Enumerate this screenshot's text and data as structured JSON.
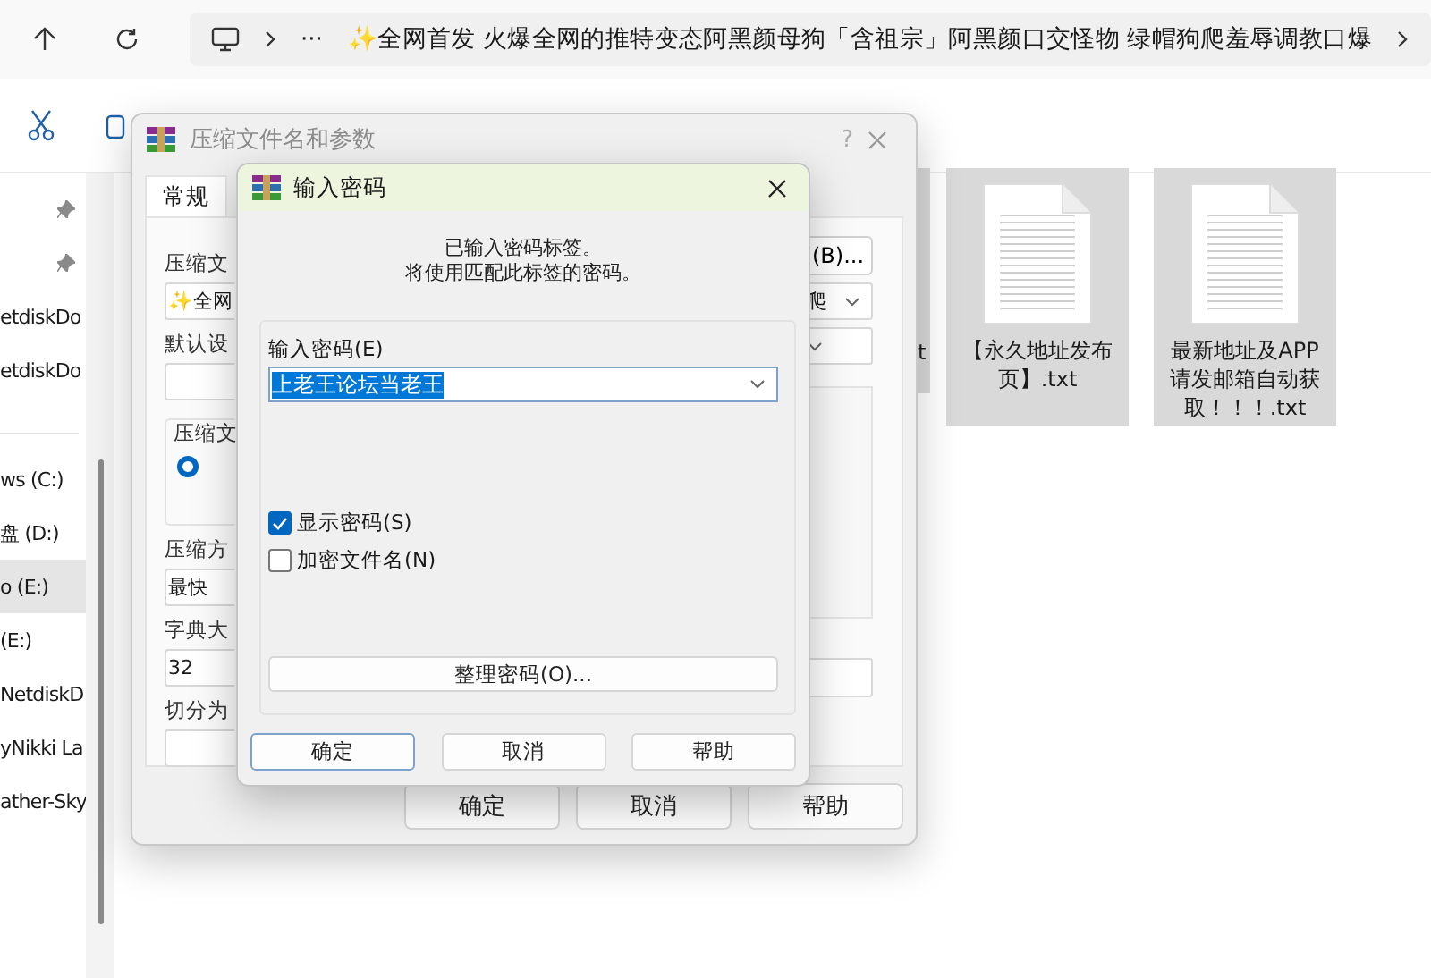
{
  "address_bar": {
    "more": "···",
    "path": "✨全网首发 火爆全网的推特变态阿黑颜母狗「含祖宗」阿黑颜口交怪物 绿帽狗爬羞辱调教口爆"
  },
  "sidebar": {
    "items": [
      {
        "pinned": true,
        "selected": false
      },
      {
        "pinned": true,
        "selected": false
      },
      {
        "label": "etdiskDo",
        "pinned": false,
        "selected": false
      },
      {
        "label": "etdiskDo",
        "pinned": false,
        "selected": false
      },
      {
        "kind": "divider"
      },
      {
        "label": "ws (C:)",
        "pinned": false,
        "selected": false
      },
      {
        "label": "盘 (D:)",
        "pinned": false,
        "selected": false
      },
      {
        "label": "o (E:)",
        "pinned": false,
        "selected": true
      },
      {
        "label": "(E:)",
        "pinned": false,
        "selected": false
      },
      {
        "label": "NetdiskD",
        "pinned": false,
        "selected": false
      },
      {
        "label": "yNikki La",
        "pinned": false,
        "selected": false
      },
      {
        "label": "ather-Sky",
        "pinned": false,
        "selected": false
      }
    ]
  },
  "files": [
    {
      "kind": "clipped",
      "name": "t",
      "selected": true
    },
    {
      "kind": "file",
      "name": "【永久地址发布页】.txt",
      "selected": true
    },
    {
      "kind": "file",
      "name": "最新地址及APP请发邮箱自动获取！！！.txt",
      "selected": true
    }
  ],
  "archive_dialog": {
    "title": "压缩文件名和参数",
    "help": "?",
    "tabs": [
      {
        "label": "常规",
        "selected": true
      }
    ],
    "left": [
      {
        "kind": "label",
        "text": "压缩文"
      },
      {
        "kind": "combo",
        "value": "✨全网"
      },
      {
        "kind": "label",
        "text": "默认设"
      },
      {
        "kind": "combo"
      },
      {
        "kind": "group",
        "text": "压缩文",
        "selected": true
      },
      {
        "kind": "label",
        "text": "压缩方"
      },
      {
        "kind": "combo",
        "value": "最快"
      },
      {
        "kind": "label",
        "text": "字典大"
      },
      {
        "kind": "combo",
        "value": "32"
      },
      {
        "kind": "label",
        "text": "切分为"
      },
      {
        "kind": "combo"
      }
    ],
    "right": [
      {
        "kind": "button",
        "text": "(B)..."
      },
      {
        "kind": "dropdown",
        "value": "爬"
      },
      {
        "kind": "dropdown"
      },
      {
        "kind": "panel"
      },
      {
        "kind": "combo"
      }
    ],
    "buttons": [
      "确定",
      "取消",
      "帮助"
    ]
  },
  "password_dialog": {
    "title": "输入密码",
    "message": [
      "已输入密码标签。",
      "将使用匹配此标签的密码。"
    ],
    "field_label": "输入密码(E)",
    "password": "上老王论坛当老王",
    "options": [
      {
        "label": "显示密码(S)",
        "checked": true
      },
      {
        "label": "加密文件名(N)",
        "checked": false
      }
    ],
    "organize_button": "整理密码(O)...",
    "buttons": [
      {
        "label": "确定",
        "default": true
      },
      {
        "label": "取消",
        "default": false
      },
      {
        "label": "帮助",
        "default": false
      }
    ]
  }
}
